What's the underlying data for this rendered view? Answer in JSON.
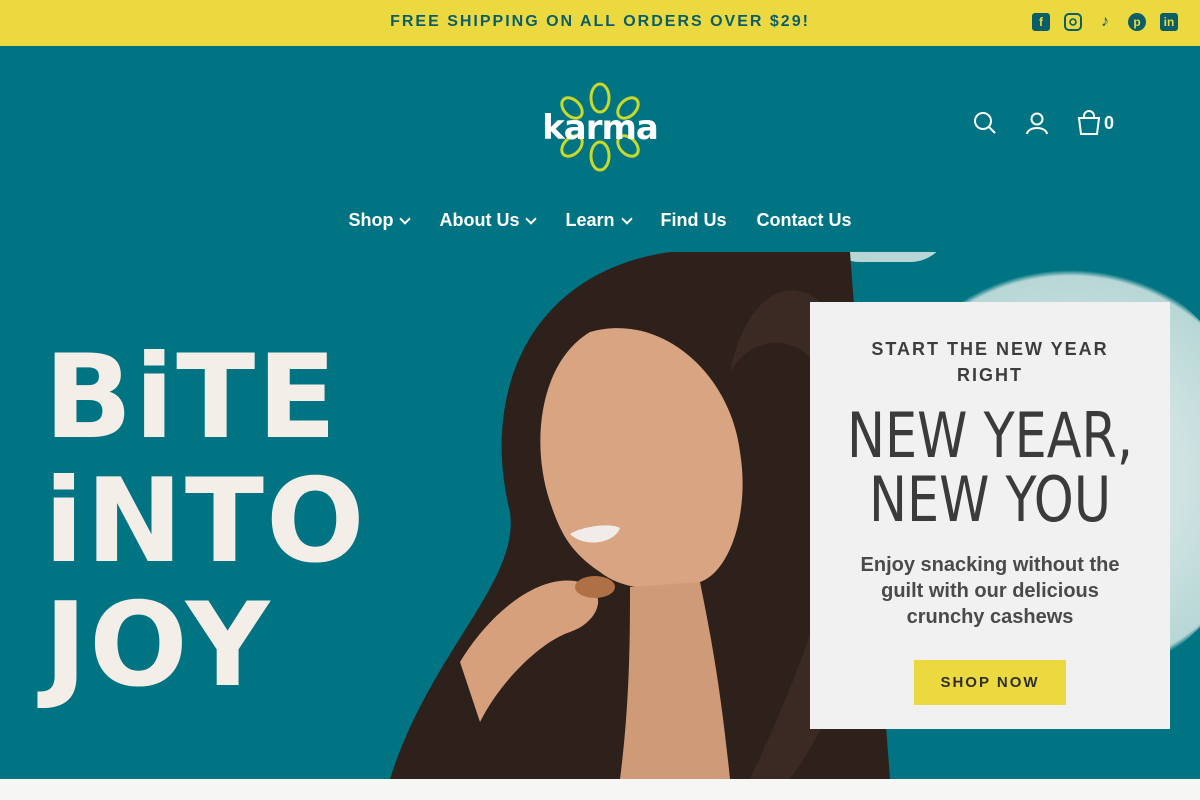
{
  "announcement": {
    "text": "FREE SHIPPING ON ALL ORDERS OVER $29!",
    "background": "#ecd93f",
    "text_color": "#0b5e68"
  },
  "social_icons": [
    "facebook-icon",
    "instagram-icon",
    "tiktok-icon",
    "pinterest-icon",
    "linkedin-icon"
  ],
  "header": {
    "logo_text": "karma",
    "background": "#007482",
    "cart_count": "0",
    "icons": [
      "search-icon",
      "account-icon",
      "cart-icon"
    ]
  },
  "nav": {
    "items": [
      {
        "label": "Shop",
        "has_dropdown": true
      },
      {
        "label": "About Us",
        "has_dropdown": true
      },
      {
        "label": "Learn",
        "has_dropdown": true
      },
      {
        "label": "Find Us",
        "has_dropdown": false
      },
      {
        "label": "Contact Us",
        "has_dropdown": false
      }
    ]
  },
  "hero": {
    "headline_lines": [
      "BiTE",
      "iNTO",
      "JOY"
    ],
    "background": "#007482",
    "promo": {
      "kicker": "START THE NEW YEAR RIGHT",
      "title_line1": "NEW YEAR,",
      "title_line2": "NEW YOU",
      "body": "Enjoy snacking without the guilt with our delicious crunchy cashews",
      "button_label": "SHOP NOW",
      "button_color": "#ecd93f"
    }
  }
}
